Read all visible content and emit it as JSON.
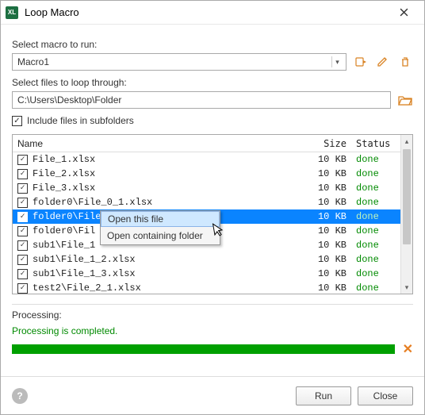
{
  "window": {
    "title": "Loop Macro",
    "app_icon_label": "XL"
  },
  "macro": {
    "label": "Select macro to run:",
    "value": "Macro1",
    "icons": {
      "run_one": "macro-run-icon",
      "edit": "pencil-icon",
      "delete": "trash-icon"
    }
  },
  "files": {
    "label": "Select files to loop through:",
    "path": "C:\\Users\\Desktop\\Folder",
    "browse_icon": "folder-open-icon",
    "include_subfolders_label": "Include files in subfolders",
    "include_subfolders_checked": true
  },
  "table": {
    "headers": {
      "name": "Name",
      "size": "Size",
      "status": "Status"
    },
    "rows": [
      {
        "checked": true,
        "name": "File_1.xlsx",
        "size": "10 KB",
        "status": "done",
        "selected": false
      },
      {
        "checked": true,
        "name": "File_2.xlsx",
        "size": "10 KB",
        "status": "done",
        "selected": false
      },
      {
        "checked": true,
        "name": "File_3.xlsx",
        "size": "10 KB",
        "status": "done",
        "selected": false
      },
      {
        "checked": true,
        "name": "folder0\\File_0_1.xlsx",
        "size": "10 KB",
        "status": "done",
        "selected": false
      },
      {
        "checked": true,
        "name": "folder0\\File_0_2.xlsx",
        "size": "10 KB",
        "status": "done",
        "selected": true
      },
      {
        "checked": true,
        "name": "folder0\\Fil",
        "size": "10 KB",
        "status": "done",
        "selected": false
      },
      {
        "checked": true,
        "name": "sub1\\File_1",
        "size": "10 KB",
        "status": "done",
        "selected": false
      },
      {
        "checked": true,
        "name": "sub1\\File_1_2.xlsx",
        "size": "10 KB",
        "status": "done",
        "selected": false
      },
      {
        "checked": true,
        "name": "sub1\\File_1_3.xlsx",
        "size": "10 KB",
        "status": "done",
        "selected": false
      },
      {
        "checked": true,
        "name": "test2\\File_2_1.xlsx",
        "size": "10 KB",
        "status": "done",
        "selected": false
      }
    ]
  },
  "context_menu": {
    "items": [
      "Open this file",
      "Open containing folder"
    ],
    "hovered_index": 0
  },
  "processing": {
    "label": "Processing:",
    "status": "Processing is completed.",
    "progress_percent": 100
  },
  "footer": {
    "run": "Run",
    "close": "Close"
  }
}
